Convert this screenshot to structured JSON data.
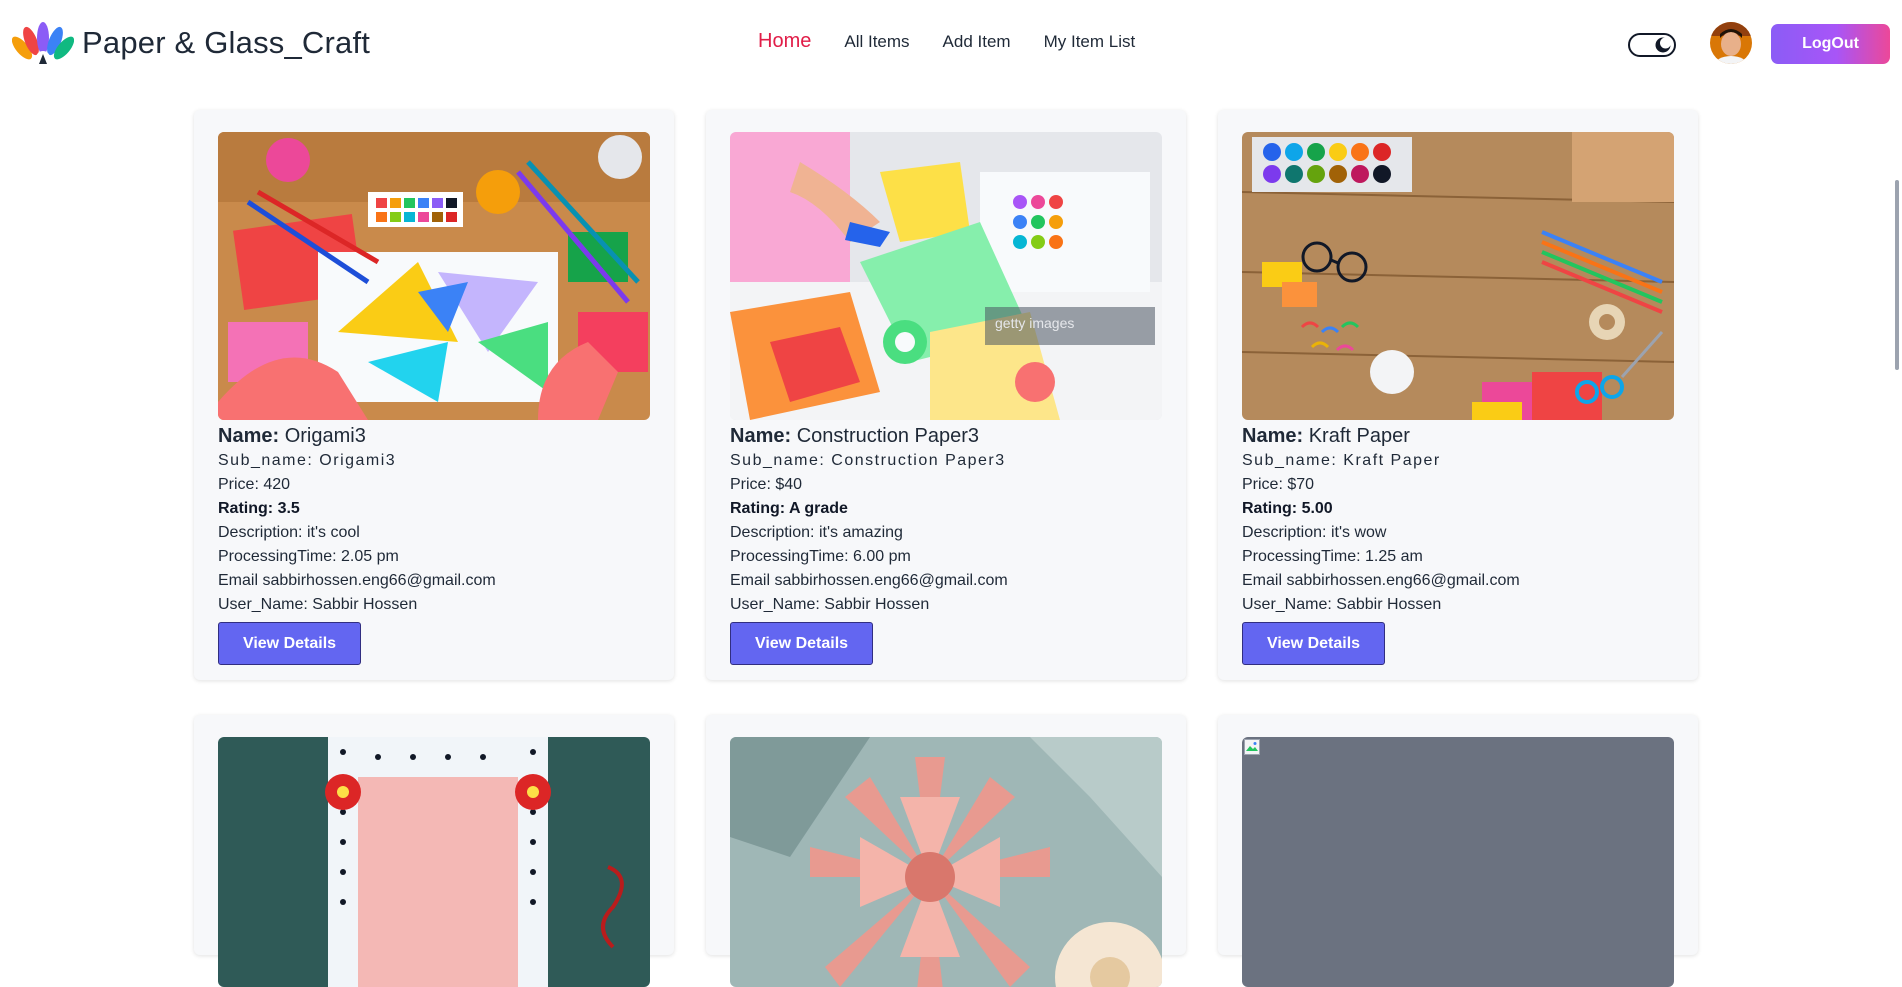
{
  "brand": {
    "name": "Paper & Glass_Craft"
  },
  "nav": {
    "links": [
      {
        "label": "Home",
        "active": true
      },
      {
        "label": "All Items",
        "active": false
      },
      {
        "label": "Add Item",
        "active": false
      },
      {
        "label": "My Item List",
        "active": false
      }
    ]
  },
  "theme_toggle": {
    "icon": "moon-icon"
  },
  "user": {
    "avatar": "user-avatar"
  },
  "logout": {
    "label": "LogOut"
  },
  "labels": {
    "name": "Name:",
    "sub_name": "Sub_name:",
    "price": "Price:",
    "rating": "Rating:",
    "description": "Description:",
    "processing": "ProcessingTime:",
    "email": "Email",
    "user_name": "User_Name:",
    "view_details": "View Details"
  },
  "items": [
    {
      "name": "Origami3",
      "sub_name": "Origami3",
      "price": "420",
      "rating": "3.5",
      "description": "it's cool",
      "processing_time": "2.05 pm",
      "email": "sabbirhossen.eng66@gmail.com",
      "user_name": "Sabbir Hossen",
      "image": "craft-supplies-photo"
    },
    {
      "name": "Construction Paper3",
      "sub_name": "Construction Paper3",
      "price": "$40",
      "rating": "A grade",
      "description": "it's amazing",
      "processing_time": "6.00 pm",
      "email": "sabbirhossen.eng66@gmail.com",
      "user_name": "Sabbir Hossen",
      "image": "paper-cutting-photo"
    },
    {
      "name": "Kraft Paper",
      "sub_name": "Kraft Paper",
      "price": "$70",
      "rating": "5.00",
      "description": "it's wow",
      "processing_time": "1.25 am",
      "email": "sabbirhossen.eng66@gmail.com",
      "user_name": "Sabbir Hossen",
      "image": "wooden-desk-photo"
    },
    {
      "image": "paper-frame-photo"
    },
    {
      "image": "paper-flower-photo"
    },
    {
      "image": "broken-image"
    }
  ]
}
